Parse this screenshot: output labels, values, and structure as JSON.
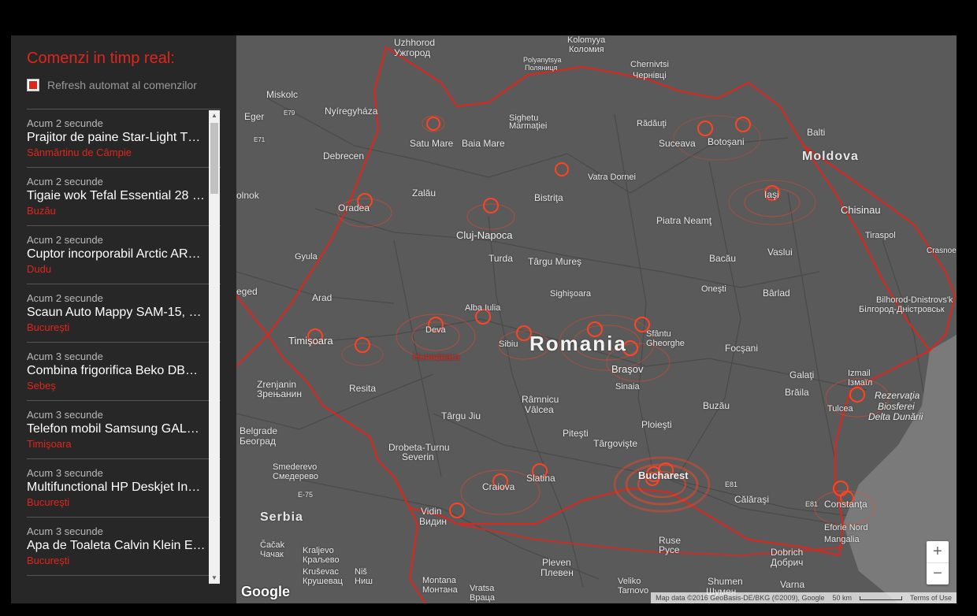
{
  "panel": {
    "title": "Comenzi in timp real:",
    "refresh_label": "Refresh automat al comenzilor",
    "refresh_checked": true,
    "orders": [
      {
        "time": "Acum 2 secunde",
        "product": "Prajitor de paine Star-Light T…",
        "city": "Sânmărtinu de Câmpie"
      },
      {
        "time": "Acum 2 secunde",
        "product": "Tigaie wok Tefal Essential 28 …",
        "city": "Buzău"
      },
      {
        "time": "Acum 2 secunde",
        "product": "Cuptor incorporabil Arctic AR…",
        "city": "Dudu"
      },
      {
        "time": "Acum 2 secunde",
        "product": "Scaun Auto Mappy SAM-15, 9…",
        "city": "Bucureşti"
      },
      {
        "time": "Acum 3 secunde",
        "product": "Combina frigorifica Beko DB…",
        "city": "Sebeş"
      },
      {
        "time": "Acum 3 secunde",
        "product": "Telefon mobil Samsung GAL…",
        "city": "Timişoara"
      },
      {
        "time": "Acum 3 secunde",
        "product": "Multifunctional HP Deskjet In…",
        "city": "Bucureşti"
      },
      {
        "time": "Acum 3 secunde",
        "product": "Apa de Toaleta Calvin Klein E…",
        "city": "Bucureşti"
      }
    ]
  },
  "map": {
    "labels": {
      "uzhhorod": "Uzhhorod",
      "uzhhorod_cyr": "Ужгород",
      "kolomyya": "Kolomyya",
      "kolomyya_cyr": "Коломия",
      "polyanytsya": "Polyanytsya",
      "polyanytsya_cyr": "Поляниця",
      "chernivtsi": "Chernivtsi",
      "chernivtsi_cyr": "Чернівці",
      "miskolc": "Miskolc",
      "eger": "Eger",
      "nyiregyhaza": "Nyíregyháza",
      "sighetu": "Sighetu",
      "marmatiei": "Marmaţiei",
      "radauti": "Rădăuţi",
      "balti": "Balti",
      "moldova": "Moldova",
      "satu_mare": "Satu Mare",
      "baia_mare": "Baia Mare",
      "suceava": "Suceava",
      "botosani": "Botoşani",
      "debrecen": "Debrecen",
      "vatra_dornei": "Vatra Dornei",
      "olnok": "olnok",
      "zalau": "Zalău",
      "bistrita": "Bistriţa",
      "iasi": "Iaşi",
      "chisinau": "Chisinau",
      "oradea": "Oradea",
      "piatra_neamt": "Piatra Neamţ",
      "cluj": "Cluj-Napoca",
      "tiraspol": "Tiraspol",
      "gyula": "Gyula",
      "turda": "Turda",
      "targu_mures": "Târgu Mureş",
      "bacau": "Bacău",
      "vaslui": "Vaslui",
      "crasnoe": "Crasnoe",
      "eged": "eged",
      "arad": "Arad",
      "sighisoara": "Sighişoara",
      "onesti": "Oneşti",
      "barlad": "Bârlad",
      "bilhorod": "Bilhorod-Dnistrovs'k",
      "bilhorod_cyr": "Білгород-Дністровськ",
      "alba_iulia": "Alba Iulia",
      "deva": "Deva",
      "sfantu": "Sfântu",
      "gheorghe": "Gheorghe",
      "timisoara": "Timişoara",
      "sibiu": "Sibiu",
      "romania": "Romania",
      "focsani": "Focşani",
      "hunedoara": "Hunedoara",
      "brasov": "Braşov",
      "zrenjanin": "Zrenjanin",
      "zrenjanin_cyr": "Зрењанин",
      "galati": "Galaţi",
      "izmail": "Izmail",
      "izmail_cyr": "Ізмаїл",
      "resita": "Resita",
      "sinaia": "Sinaia",
      "braila": "Brăila",
      "ramnicu": "Râmnicu",
      "valcea": "Vâlcea",
      "rezervatia": "Rezervaţia",
      "biosferei": "Biosferei",
      "delta": "Delta Dunării",
      "buzau": "Buzău",
      "tulcea": "Tulcea",
      "targu_jiu": "Târgu Jiu",
      "belgrade": "Belgrade",
      "belgrade_cyr": "Београд",
      "ploiesti": "Ploieşti",
      "drobeta": "Drobeta-Turnu",
      "severin": "Severin",
      "pitesti": "Piteşti",
      "targoviste": "Târgovişte",
      "smederevo": "Smederevo",
      "smederevo_cyr": "Смедерево",
      "e75": "E-75",
      "slatina": "Slatina",
      "bucharest": "Bucharest",
      "e81": "E81",
      "craiova": "Craiova",
      "calarasi": "Călăraşi",
      "e81b": "E81",
      "constanta": "Constanţa",
      "serbia": "Serbia",
      "vidin": "Vidin",
      "vidin_cyr": "Видин",
      "eforie": "Eforie Nord",
      "mangalia": "Mangalia",
      "ruse": "Ruse",
      "ruse_cyr": "Русе",
      "cacak": "Čačak",
      "cacak_cyr": "Чачак",
      "kraljevo": "Kraljevo",
      "kraljevo_cyr": "Краљево",
      "dobrich": "Dobrich",
      "dobrich_cyr": "Добрич",
      "krusevac": "Kruševac",
      "krusevac_cyr": "Крушевац",
      "nis": "Niš",
      "nis_cyr": "Ниш",
      "pleven": "Pleven",
      "pleven_cyr": "Плевен",
      "montana": "Montana",
      "montana_cyr": "Монтана",
      "vratsa": "Vratsa",
      "vratsa_cyr": "Враца",
      "veliko": "Veliko",
      "tarnovo": "Tarnovo",
      "shumen": "Shumen",
      "shumen_cyr": "Шумен",
      "varna": "Varna",
      "varna_cyr": "Варна",
      "e79": "E79",
      "e71": "E71"
    },
    "zoom_in": "+",
    "zoom_out": "−",
    "google": "Google",
    "attribution": "Map data ©2016 GeoBasis-DE/BKG (©2009), Google",
    "scale": "50 km",
    "terms": "Terms of Use",
    "colors": {
      "accent": "#e0251b",
      "map_bg": "#5a5a5a"
    }
  }
}
